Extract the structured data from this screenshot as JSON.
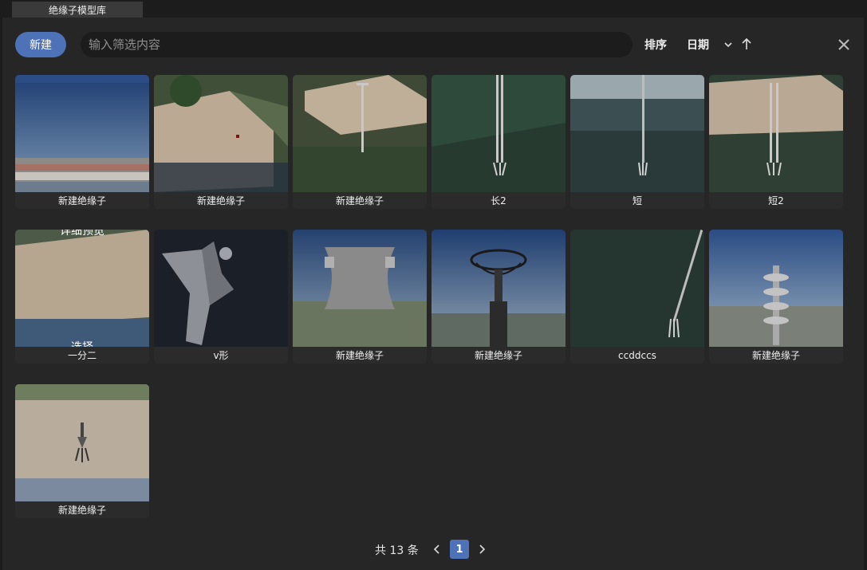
{
  "window": {
    "tab_title": "绝缘子模型库"
  },
  "toolbar": {
    "new_label": "新建",
    "search_placeholder": "输入筛选内容",
    "search_value": "",
    "sort_label": "排序",
    "sort_value": "日期",
    "sort_direction": "ascending"
  },
  "items": [
    {
      "label": "新建绝缘子"
    },
    {
      "label": "新建绝缘子"
    },
    {
      "label": "新建绝缘子"
    },
    {
      "label": "长2"
    },
    {
      "label": "短"
    },
    {
      "label": "短2"
    },
    {
      "label": "一分二",
      "thumb_text_top": "详细预览",
      "thumb_text_bottom": "选择"
    },
    {
      "label": "v形"
    },
    {
      "label": "新建绝缘子"
    },
    {
      "label": "新建绝缘子"
    },
    {
      "label": "ccddccs"
    },
    {
      "label": "新建绝缘子"
    },
    {
      "label": "新建绝缘子"
    }
  ],
  "pagination": {
    "total_text": "共 13 条",
    "current_page": "1"
  },
  "colors": {
    "accent": "#4d72b8",
    "panel": "#262626",
    "background": "#1c1c1c"
  }
}
